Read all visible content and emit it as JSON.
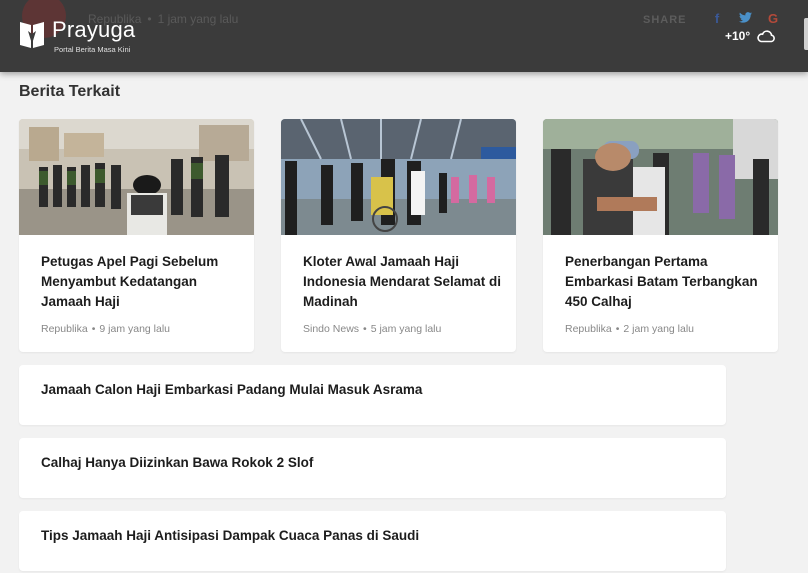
{
  "header": {
    "logo_name": "Prayuga",
    "logo_tagline": "Portal Berita Masa Kini",
    "share_label": "SHARE",
    "share_icons": [
      "facebook-icon",
      "twitter-icon",
      "google-plus-icon"
    ],
    "weather": {
      "temperature": "+10°",
      "icon": "cloud-icon"
    },
    "background_article_meta": {
      "source": "Republika",
      "time": "1 jam yang lalu"
    }
  },
  "section": {
    "title": "Berita Terkait"
  },
  "cards": [
    {
      "title": "Petugas Apel Pagi Sebelum Menyambut Kedatangan Jamaah Haji",
      "source": "Republika",
      "time": "9 jam yang lalu"
    },
    {
      "title": "Kloter Awal Jamaah Haji Indonesia Mendarat Selamat di Madinah",
      "source": "Sindo News",
      "time": "5 jam yang lalu"
    },
    {
      "title": "Penerbangan Pertama Embarkasi Batam Terbangkan 450 Calhaj",
      "source": "Republika",
      "time": "2 jam yang lalu"
    }
  ],
  "list": [
    {
      "title": "Jamaah Calon Haji Embarkasi Padang Mulai Masuk Asrama"
    },
    {
      "title": "Calhaj Hanya Diizinkan Bawa Rokok 2 Slof"
    },
    {
      "title": "Tips Jamaah Haji Antisipasi Dampak Cuaca Panas di Saudi"
    }
  ],
  "colors": {
    "header_bg": "#3b3b3b",
    "page_bg": "#f2f2f2",
    "facebook": "#3b5998",
    "twitter": "#4a90c8",
    "google": "#b44a3a"
  }
}
